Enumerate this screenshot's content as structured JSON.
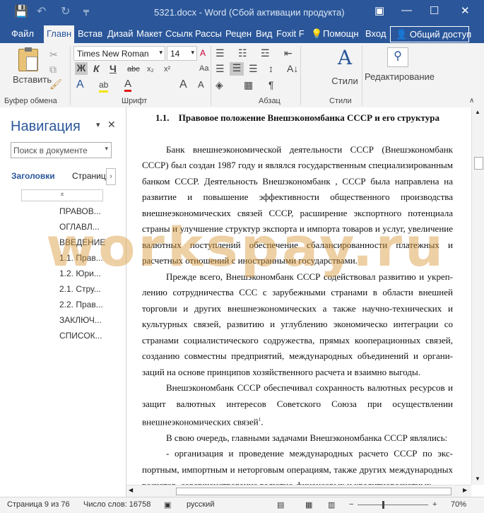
{
  "titlebar": {
    "title": "5321.docx - Word (Сбой активации продукта)",
    "save_icon": "💾",
    "undo_icon": "↶",
    "redo_icon": "↻",
    "customize_icon": "╤",
    "help_icon": "▣",
    "minimize_icon": "—",
    "maximize_icon": "☐",
    "close_icon": "✕"
  },
  "tabs": [
    "Файл",
    "Главн",
    "Встав",
    "Дизай",
    "Макет",
    "Ссылк",
    "Рассы",
    "Рецен",
    "Вид",
    "Foxit F"
  ],
  "help": {
    "label": "Помощн",
    "icon": "💡"
  },
  "signin": "Вход",
  "share": {
    "label": "Общий доступ",
    "icon": "👤"
  },
  "ribbon": {
    "paste_label": "Вставить",
    "clipboard_label": "Буфер обмена",
    "font_group_label": "Шрифт",
    "paragraph_group_label": "Абзац",
    "styles_group_label": "Стили",
    "font_name": "Times New Roman",
    "font_size": "14",
    "bold": "Ж",
    "italic": "К",
    "underline": "Ч",
    "strike": "abc",
    "subscript": "x₂",
    "superscript": "x²",
    "text_effects": "A",
    "highlight": "ab",
    "font_color": "A",
    "grow_font": "A",
    "shrink_font": "A",
    "case": "Aa",
    "clear": "A",
    "styles_label": "Стили",
    "editing_label": "Редактирование",
    "pilcrow": "¶",
    "sort": "A↓",
    "accent_color": "#2b579a"
  },
  "nav": {
    "title": "Навигация",
    "search_placeholder": "Поиск в документе",
    "tab_headings": "Заголовки",
    "tab_pages": "Страниц",
    "items": [
      "ПРАВОВ...",
      "ОГЛАВЛ...",
      "ВВЕДЕНИЕ",
      "1.1. Прав...",
      "1.2. Юри...",
      "2.1. Стру...",
      "2.2. Прав...",
      "ЗАКЛЮЧ...",
      "СПИСОК..."
    ],
    "top_marker": "⌅"
  },
  "document": {
    "heading_num": "1.1.",
    "heading": "Правовое положение Внешэкономбанка СССР и его структура",
    "p1": "Банк внешнеэкономической деятельности СССР (Внешэкономбанк СССР) был создан 1987 году и являлся государственным специализированным банком СССР. Деятельность Внешэкономбанк , СССР была направлена на развитие и повышение эффективности общественного производства внешнеэкономических связей СССР, расширение экспортного потенциала страны и улучшение структур экспорта и импорта товаров и услуг, увеличение валютных поступлений обеспечение сбалансированности платежных и расчетных отношений с иностранными государствами.",
    "p2": "Прежде всего, Внешэкономбанк СССР содействовал развитию и укреп-лению сотрудничества ССС с зарубежными странами в области внешней торговли и других внешнеэкономических а также научно-технических и культурных связей, развитию и углублению экономическо интеграции со странами социалистического содружества, прямых кооперационных связей, созданию совместны предприятий, международных объединений и органи-заций на основе принципов хозяйственного расчета и взаимно выгоды.",
    "p3": "Внешэкономбанк СССР обеспечивал сохранность валютных ресурсов и защит валютных интересов Советского Союза при осуществлении внешнеэкономических связей",
    "p3_footnote": "1",
    "p3_end": ".",
    "p4": "В свою очередь, главными задачами Внешэкономбанка СССР являлись:",
    "p5": "- организация и проведение международных расчето СССР по экс-портным, импортным и неторговым операциям, также других международных расчетов, совершенствование валютно-финансовых и кредитнорасчетных"
  },
  "watermark": "workspay.ru",
  "status": {
    "page": "Страница 9 из 76",
    "words": "Число слов: 16758",
    "language": "русский",
    "zoom": "70%",
    "zoom_minus": "−",
    "zoom_plus": "+"
  }
}
